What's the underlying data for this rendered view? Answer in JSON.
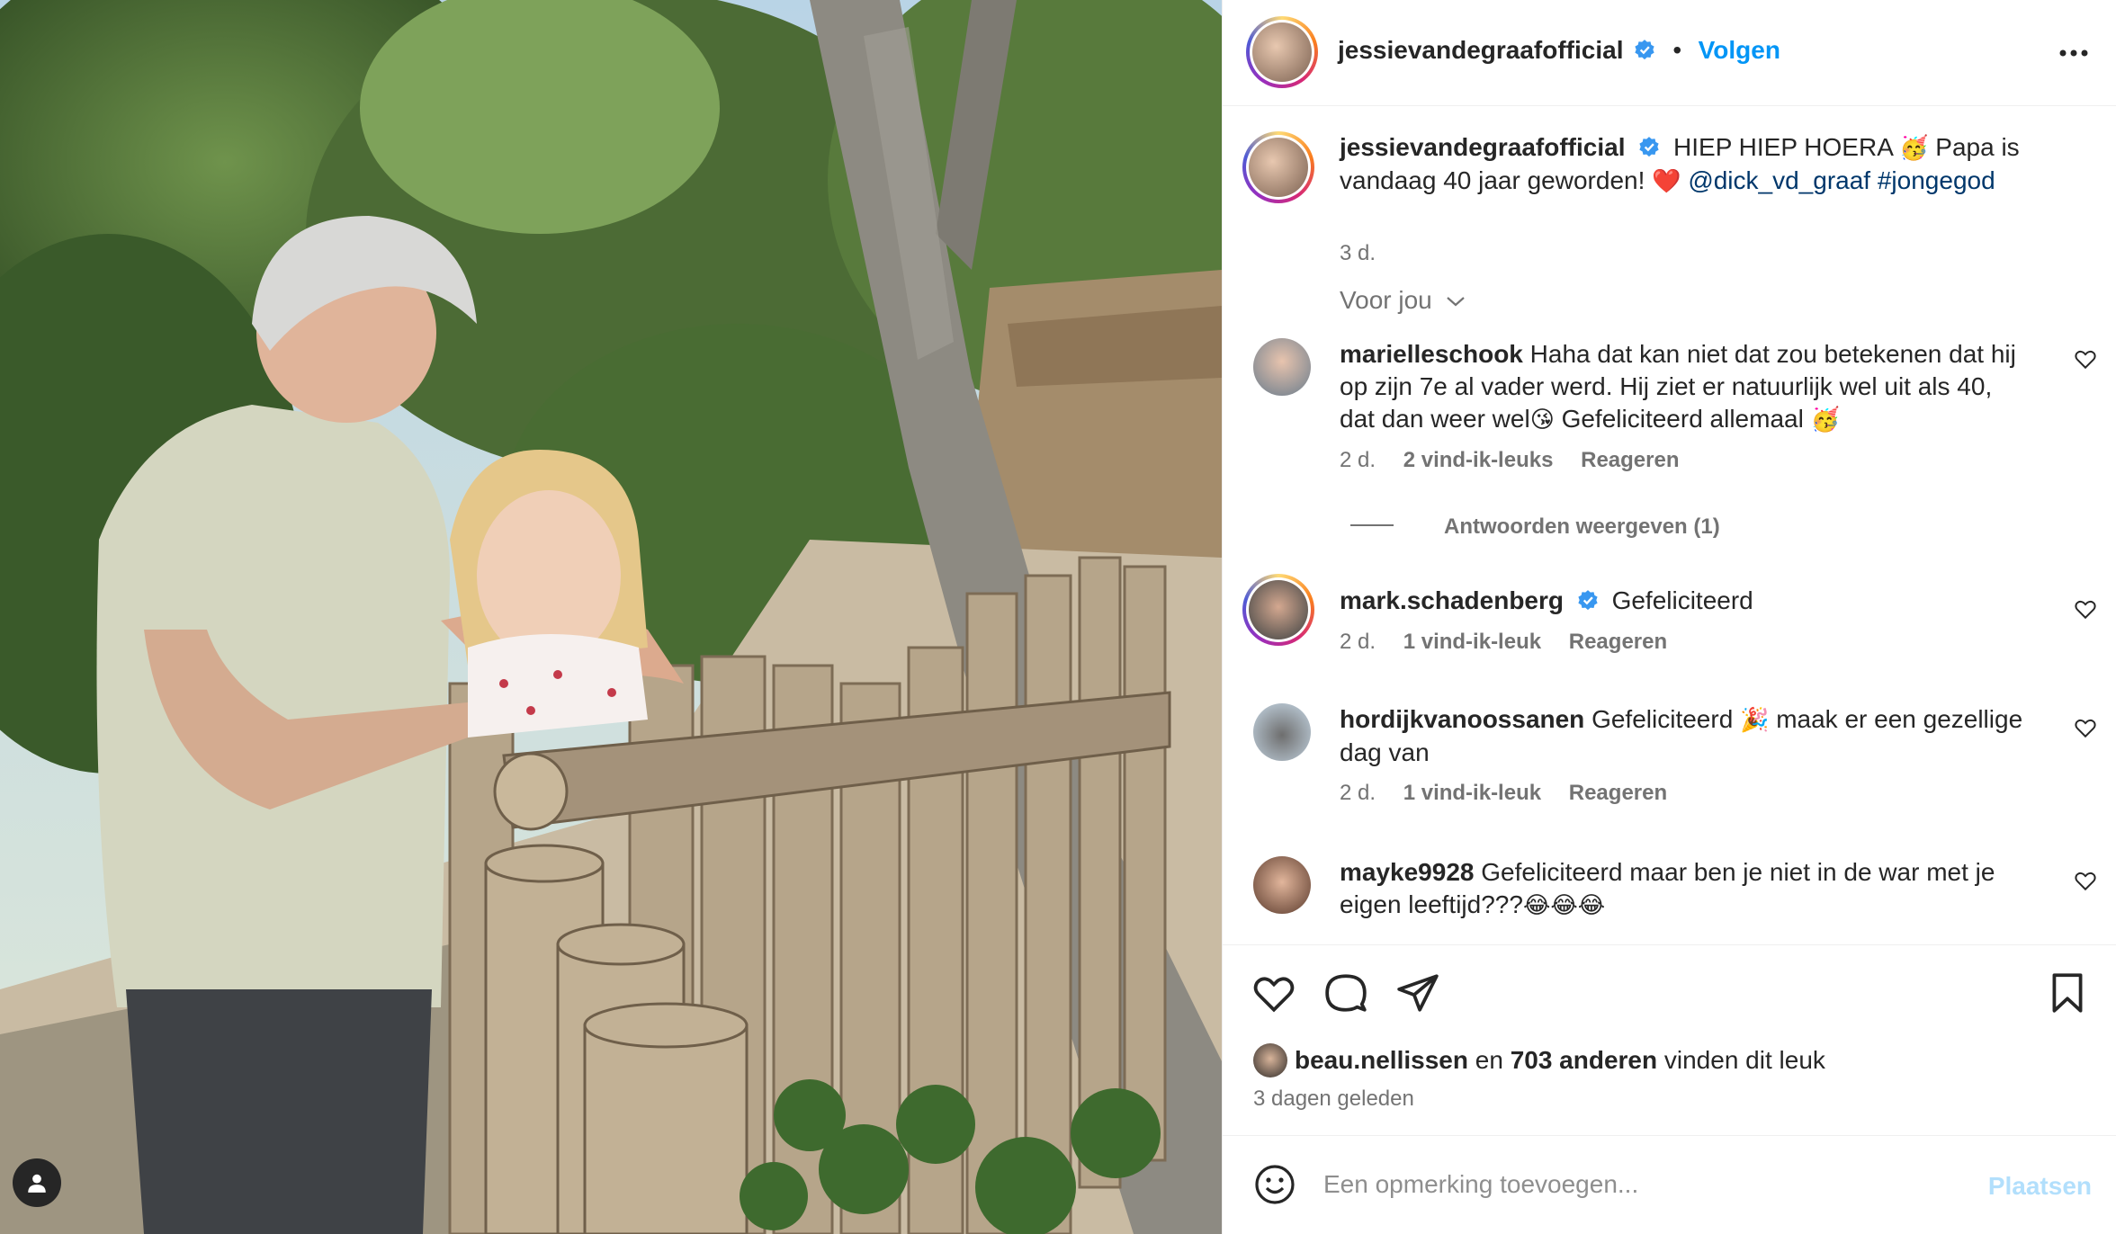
{
  "post": {
    "author": "jessievandegraafofficial",
    "verified": true,
    "follow_dot": "•",
    "follow_label": "Volgen",
    "caption": {
      "username": "jessievandegraafofficial",
      "text_1": "HIEP HIEP HOERA",
      "emoji_1": "🥳",
      "text_2": "Papa is vandaag 40 jaar geworden!",
      "emoji_2": "❤️",
      "mention": "@dick_vd_graaf",
      "hashtag": "#jongegod",
      "time": "3 d."
    },
    "for_you_label": "Voor jou"
  },
  "comments": [
    {
      "username": "marielleschook",
      "text_a": "Haha dat kan niet dat zou betekenen dat hij op zijn 7e al vader werd. Hij ziet er natuurlijk wel uit als 40, dat dan weer wel",
      "emoji_a": "😘",
      "text_b": "Gefeliciteerd allemaal",
      "emoji_b": "🥳",
      "time": "2 d.",
      "likes": "2 vind-ik-leuks",
      "reply": "Reageren",
      "view_replies": "Antwoorden weergeven (1)"
    },
    {
      "username": "mark.schadenberg",
      "verified": true,
      "text_a": "Gefeliciteerd",
      "time": "2 d.",
      "likes": "1 vind-ik-leuk",
      "reply": "Reageren"
    },
    {
      "username": "hordijkvanoossanen",
      "text_a": "Gefeliciteerd",
      "emoji_a": "🎉",
      "text_b": "maak er een gezellige dag van",
      "time": "2 d.",
      "likes": "1 vind-ik-leuk",
      "reply": "Reageren"
    },
    {
      "username": "mayke9928",
      "text_a": "Gefeliciteerd maar ben je niet in de war met je eigen leeftijd???",
      "emoji_a": "😂😂😂"
    }
  ],
  "likes_line": {
    "liker": "beau.nellissen",
    "and": "en",
    "others": "703 anderen",
    "suffix": "vinden dit leuk"
  },
  "posted_ago": "3 dagen geleden",
  "add_comment": {
    "placeholder": "Een opmerking toevoegen...",
    "post_label": "Plaatsen"
  },
  "colors": {
    "accent": "#0095f6",
    "verified": "#3897f0",
    "link": "#00376b",
    "muted": "#737373",
    "post_disabled": "#b2dffc"
  },
  "icons": [
    "user-tag-icon",
    "more-options-icon",
    "verified-badge-icon",
    "chevron-down-icon",
    "heart-icon",
    "comment-icon",
    "share-icon",
    "bookmark-icon",
    "emoji-icon"
  ]
}
